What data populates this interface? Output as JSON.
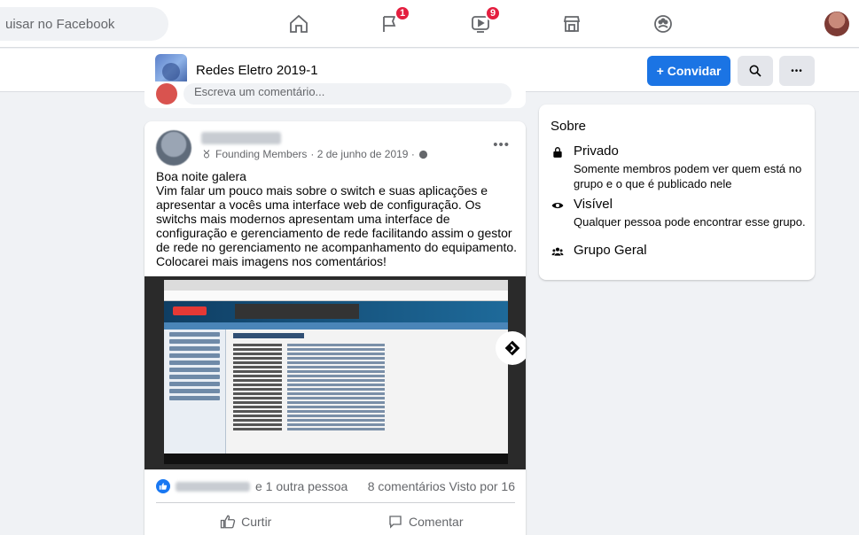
{
  "topnav": {
    "search_text": "uisar no Facebook",
    "badges": {
      "groups": "1",
      "watch": "9"
    }
  },
  "group": {
    "name": "Redes Eletro 2019-1",
    "invite_label": "Convidar",
    "invite_plus": "+"
  },
  "comment_box": {
    "placeholder": "Escreva um comentário..."
  },
  "post": {
    "role": "Founding Members",
    "date": "· 2 de junho de 2019 ·",
    "more": "•••",
    "text_lines": [
      "Boa noite galera",
      "Vim falar um pouco mais sobre o switch e suas aplicações e apresentar a vocês uma interface web  de configuração. Os switchs mais modernos apresentam uma interface de configuração e gerenciamento de rede facilitando assim o gestor de rede no gerenciamento ne acompanhamento do equipamento. Colocarei mais imagens nos comentários!"
    ],
    "likes_suffix": "e 1 outra pessoa",
    "comments_count": "8 comentários",
    "seen_by": "Visto por 16",
    "like_label": "Curtir",
    "comment_label": "Comentar"
  },
  "about": {
    "title": "Sobre",
    "items": [
      {
        "icon": "lock-icon",
        "title": "Privado",
        "desc": "Somente membros podem ver quem está no grupo e o que é publicado nele"
      },
      {
        "icon": "eye-icon",
        "title": "Visível",
        "desc": "Qualquer pessoa pode encontrar esse grupo."
      },
      {
        "icon": "people-icon",
        "title": "Grupo Geral",
        "desc": ""
      }
    ]
  },
  "colors": {
    "accent": "#1b74e4",
    "badge": "#e41e3f",
    "background": "#f0f2f5"
  }
}
